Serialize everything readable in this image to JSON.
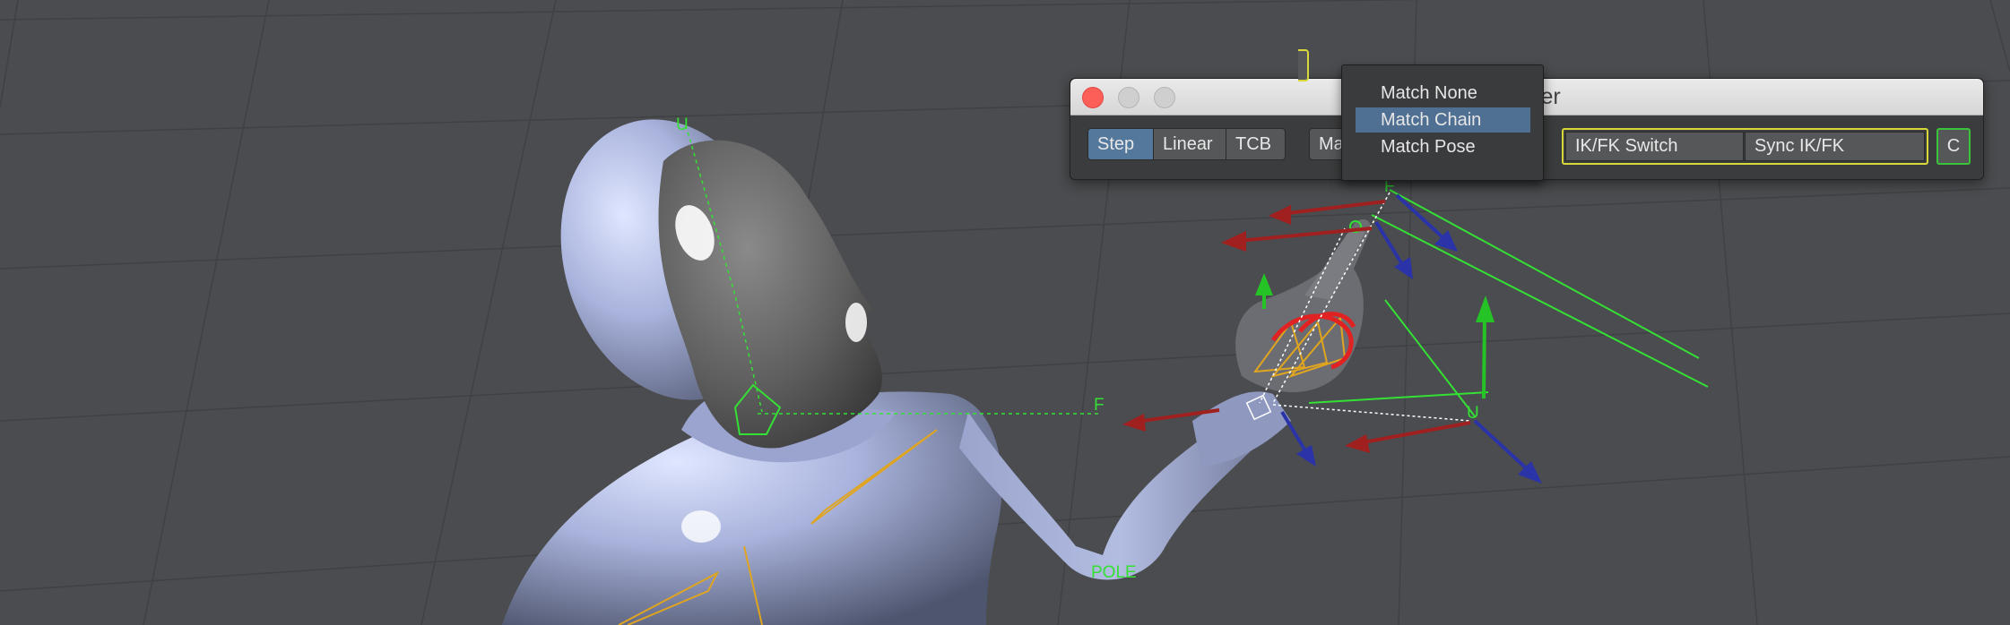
{
  "viewport": {
    "labels": {
      "head_up": "U",
      "head_forward": "F",
      "hand_forward": "F",
      "hand_up": "U",
      "pole": "POLE"
    }
  },
  "window": {
    "title": "ster",
    "buttons": {
      "close": "close",
      "minimize": "minimize",
      "maximize": "maximize"
    },
    "toolbar": {
      "interpolation": [
        "Step",
        "Linear",
        "TCB"
      ],
      "selected_interpolation": "Step",
      "match_label": "Ma",
      "ikfk_switch_label": "IK/FK Switch",
      "sync_label": "Sync IK/FK",
      "c_label": "C"
    }
  },
  "match_menu": {
    "items": [
      "Match None",
      "Match Chain",
      "Match Pose"
    ],
    "selected": "Match Chain"
  },
  "colors": {
    "viewport_bg": "#4a4c4f",
    "accent_selected": "#54779c",
    "group_outline": "#d8d838",
    "c_outline": "#3ac43a",
    "character": "#a7b1d6",
    "axis_x": "#a02020",
    "axis_y": "#26c326",
    "axis_z": "#2b33a8",
    "bones": "#e0a520"
  }
}
